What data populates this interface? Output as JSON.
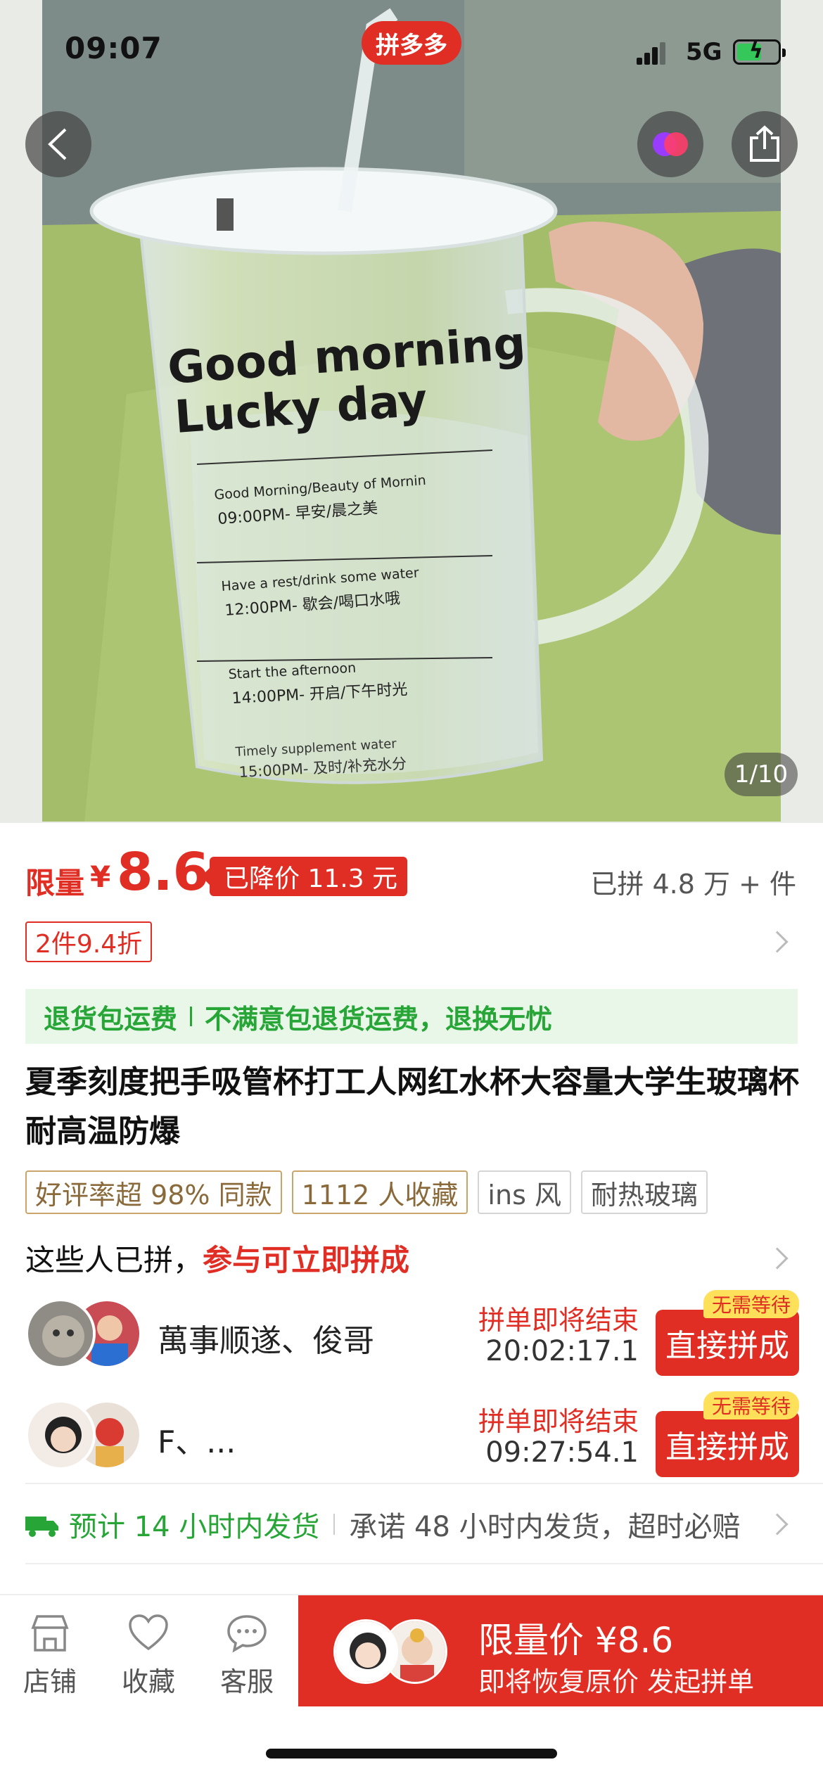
{
  "status_bar": {
    "time": "09:07",
    "network": "5G",
    "brand": "拼多多"
  },
  "hero": {
    "page_counter": "1/10",
    "cup_print": {
      "headline_1": "Good morning",
      "headline_2": "Lucky day",
      "line_1_en": "Good Morning/Beauty of Mornin",
      "line_1_cn": "09:00PM- 早安/晨之美",
      "line_2_en": "Have a rest/drink some water",
      "line_2_cn": "12:00PM- 歇会/喝口水哦",
      "line_3_en": "Start the afternoon",
      "line_3_cn": "14:00PM- 开启/下午时光",
      "line_4_en": "Timely supplement water",
      "line_4_cn": "15:00PM- 及时/补充水分"
    }
  },
  "price": {
    "limited_label": "限量",
    "currency": "¥",
    "value": "8.6",
    "drop_tag": "已降价 11.3 元",
    "sold": "已拼 4.8 万 + 件"
  },
  "discount": {
    "tag": "2件9.4折"
  },
  "guarantee": {
    "part_1": "退货包运费",
    "part_2": "不满意包退货运费，退换无忧"
  },
  "product": {
    "title": "夏季刻度把手吸管杯打工人网红水杯大容量大学生玻璃杯耐高温防爆",
    "tags": [
      "好评率超 98% 同款",
      "1112 人收藏",
      "ins 风",
      "耐热玻璃"
    ]
  },
  "group_buy": {
    "heading": "这些人已拼，",
    "heading_highlight": "参与可立即拼成",
    "rows": [
      {
        "name": "萬事顺遂、俊哥",
        "ending": "拼单即将结束",
        "countdown": "20:02:17.1",
        "badge": "无需等待",
        "button": "直接拼成"
      },
      {
        "name": "F、...",
        "ending": "拼单即将结束",
        "countdown": "09:27:54.1",
        "badge": "无需等待",
        "button": "直接拼成"
      }
    ]
  },
  "shipping": {
    "estimate": "预计 14 小时内发货",
    "promise": "承诺 48 小时内发货，超时必赔"
  },
  "bottom_bar": {
    "shop": "店铺",
    "favorite": "收藏",
    "service": "客服",
    "buy_price": "限量价 ¥8.6",
    "buy_sub": "即将恢复原价 发起拼单"
  },
  "colors": {
    "brand_red": "#e02e24",
    "green": "#27a637",
    "gold_border": "#c9a46b"
  },
  "icons": [
    "back-icon",
    "mini-program-icon",
    "share-icon",
    "truck-icon",
    "shop-icon",
    "heart-icon",
    "chat-icon"
  ]
}
